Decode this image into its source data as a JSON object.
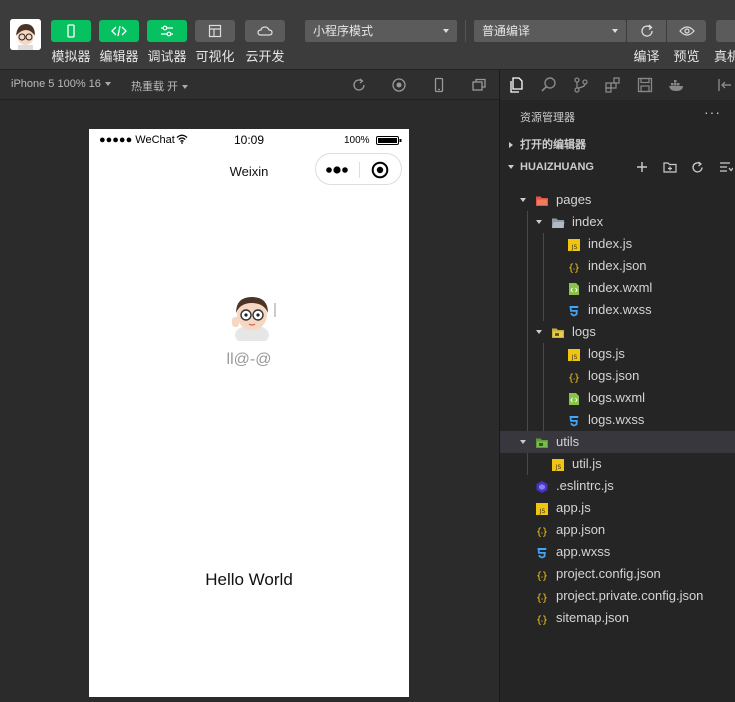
{
  "toolbar": {
    "simulator": "模拟器",
    "editor": "编辑器",
    "debugger": "调试器",
    "visual": "可视化",
    "cloud": "云开发",
    "mode_select": "小程序模式",
    "compile_select": "普通编译",
    "compile": "编译",
    "preview": "预览",
    "realdevice": "真机"
  },
  "simbar": {
    "device": "iPhone 5 100% 16",
    "hot_reload": "热重载 开"
  },
  "phone": {
    "signal": "●●●●● WeChat",
    "time": "10:09",
    "battery": "100%",
    "nav_title": "Weixin",
    "nickname": "ll@-@",
    "hello": "Hello World"
  },
  "explorer": {
    "title": "资源管理器",
    "more": "···",
    "open_editors": "打开的编辑器",
    "project": "HUAIZHUANG"
  },
  "tree": [
    {
      "label": "pages",
      "icon": "folder-red-icon",
      "depth": 1,
      "arrow": "down"
    },
    {
      "label": "index",
      "icon": "folder-gray-icon",
      "depth": 2,
      "arrow": "down"
    },
    {
      "label": "index.js",
      "icon": "js-icon",
      "depth": 3
    },
    {
      "label": "index.json",
      "icon": "json-icon",
      "depth": 3
    },
    {
      "label": "index.wxml",
      "icon": "wxml-icon",
      "depth": 3
    },
    {
      "label": "index.wxss",
      "icon": "wxss-icon",
      "depth": 3
    },
    {
      "label": "logs",
      "icon": "folder-yellow-icon",
      "depth": 2,
      "arrow": "down"
    },
    {
      "label": "logs.js",
      "icon": "js-icon",
      "depth": 3
    },
    {
      "label": "logs.json",
      "icon": "json-icon",
      "depth": 3
    },
    {
      "label": "logs.wxml",
      "icon": "wxml-icon",
      "depth": 3
    },
    {
      "label": "logs.wxss",
      "icon": "wxss-icon",
      "depth": 3
    },
    {
      "label": "utils",
      "icon": "folder-green-icon",
      "depth": 1,
      "arrow": "down",
      "selected": true
    },
    {
      "label": "util.js",
      "icon": "js-icon",
      "depth": 2
    },
    {
      "label": ".eslintrc.js",
      "icon": "eslint-icon",
      "depth": 1
    },
    {
      "label": "app.js",
      "icon": "js-icon",
      "depth": 1
    },
    {
      "label": "app.json",
      "icon": "json-icon",
      "depth": 1
    },
    {
      "label": "app.wxss",
      "icon": "wxss-icon",
      "depth": 1
    },
    {
      "label": "project.config.json",
      "icon": "json-icon",
      "depth": 1
    },
    {
      "label": "project.private.config.json",
      "icon": "json-icon",
      "depth": 1
    },
    {
      "label": "sitemap.json",
      "icon": "json-icon",
      "depth": 1
    }
  ],
  "colors": {
    "accent_green": "#07c160",
    "js": "#f1c40f",
    "json": "#f5c518",
    "wxml": "#8bc34a",
    "wxss": "#42a5f5"
  }
}
